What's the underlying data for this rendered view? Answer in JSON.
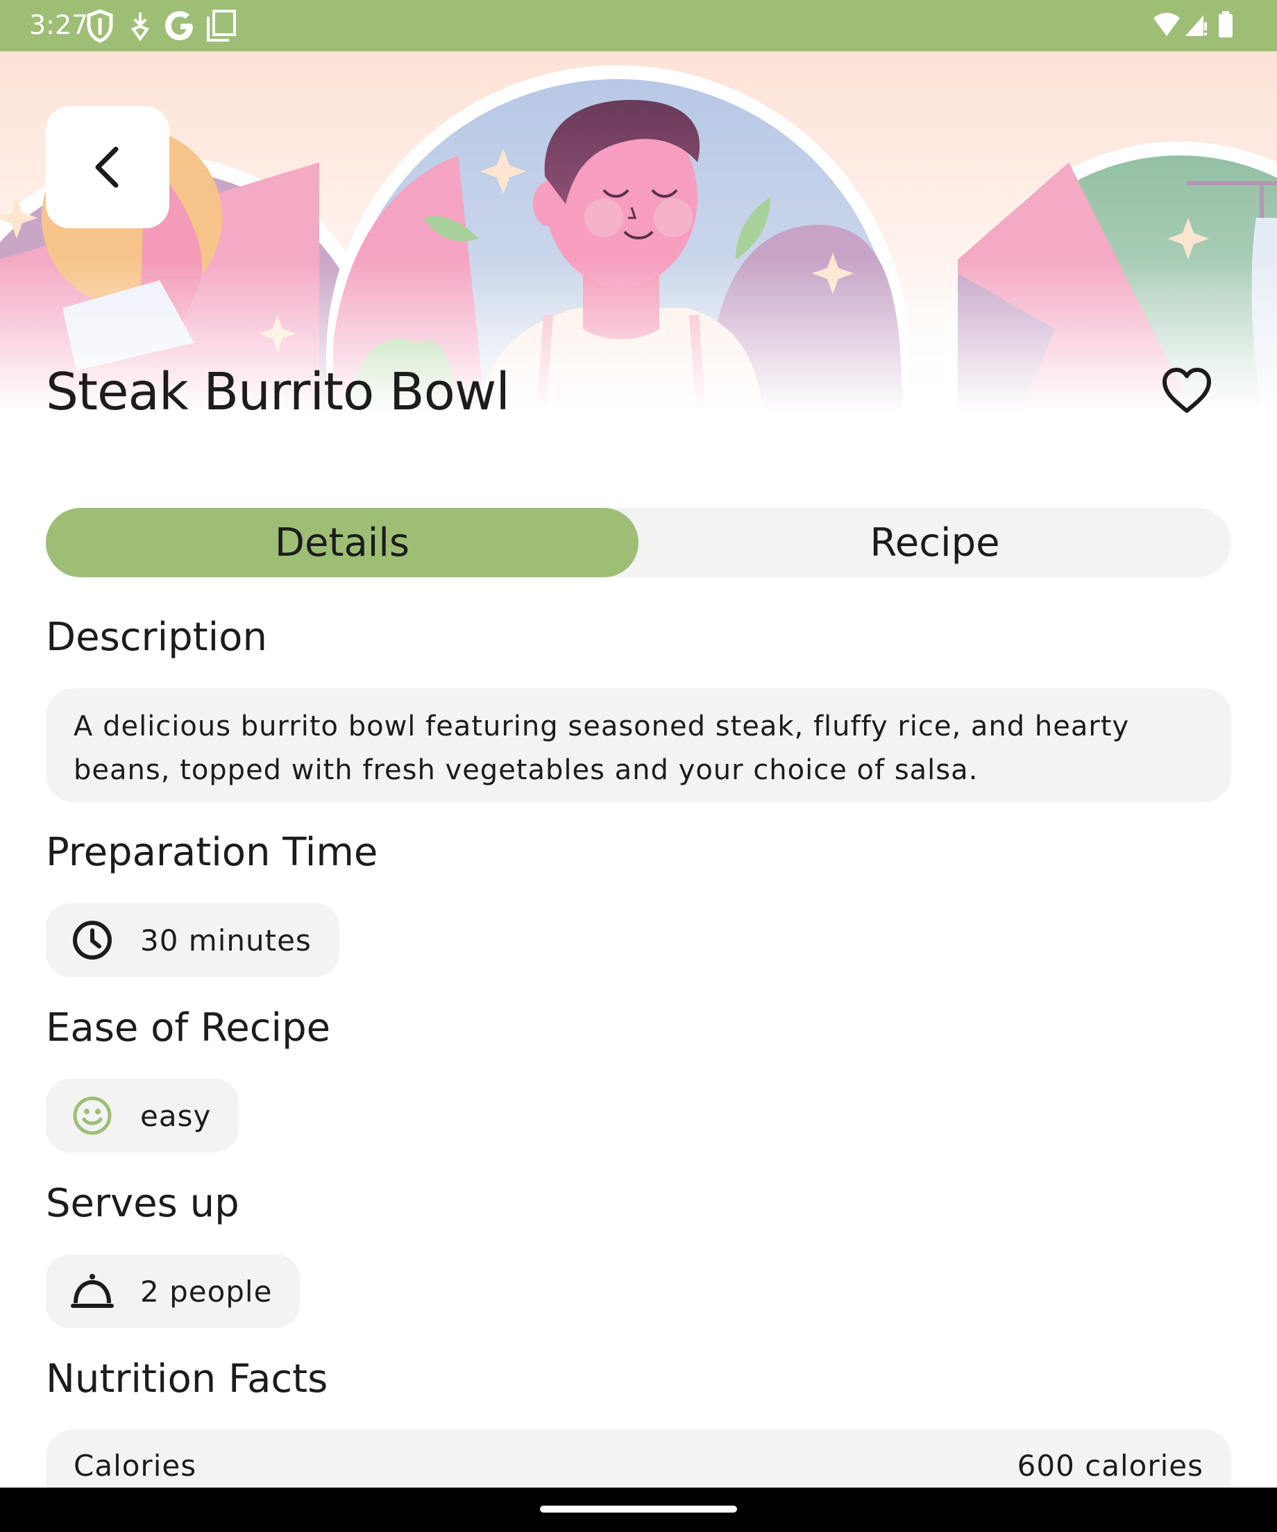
{
  "status_bar": {
    "time": "3:27",
    "icons_left": [
      "shield-icon",
      "download-icon",
      "google-icon",
      "screenshot-icon"
    ],
    "icons_right": [
      "wifi-icon",
      "signal-icon",
      "battery-icon"
    ],
    "background": "#9ebe76"
  },
  "hero": {
    "icons": [
      "back-chevron-icon",
      "heart-outline-icon"
    ]
  },
  "recipe": {
    "title": "Steak Burrito Bowl"
  },
  "tabs": [
    {
      "label": "Details",
      "selected": true
    },
    {
      "label": "Recipe",
      "selected": false
    }
  ],
  "sections": {
    "description": {
      "title": "Description",
      "text_line1": "A delicious burrito bowl featuring seasoned steak, fluffy rice, and hearty",
      "text_line2": "beans, topped with fresh vegetables and your choice of salsa."
    },
    "prep_time": {
      "title": "Preparation Time",
      "value": "30 minutes",
      "icon": "clock-icon"
    },
    "ease": {
      "title": "Ease of Recipe",
      "value": "easy",
      "icon": "smiley-icon",
      "icon_color": "#9ebe76"
    },
    "serves": {
      "title": "Serves up",
      "value": "2 people",
      "icon": "cloche-icon"
    },
    "nutrition": {
      "title": "Nutrition Facts",
      "rows": [
        {
          "label": "Calories",
          "value": "600 calories"
        }
      ]
    }
  },
  "colors": {
    "accent": "#9ebe76",
    "surface": "#f3f3f3",
    "text": "#1c1c1c"
  }
}
